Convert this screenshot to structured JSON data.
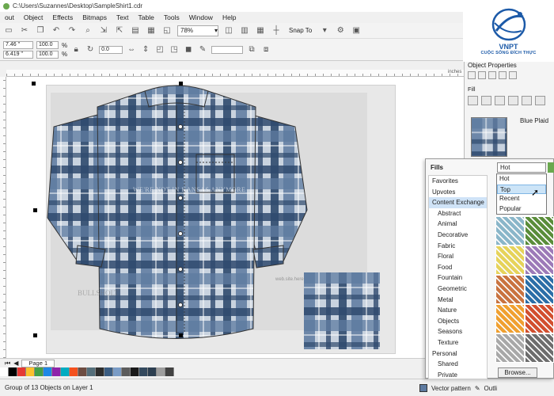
{
  "window": {
    "title": "C:\\Users\\Suzannes\\Desktop\\SampleShirt1.cdr"
  },
  "menu": [
    "out",
    "Object",
    "Effects",
    "Bitmaps",
    "Text",
    "Table",
    "Tools",
    "Window",
    "Help"
  ],
  "logo": {
    "brand": "VNPT",
    "tagline": "CUỘC SỐNG ĐÍCH THỰC"
  },
  "toolbar": {
    "zoom": "78%",
    "snap": "Snap To"
  },
  "propbar": {
    "x": "7.46 \"",
    "y": "6.419 \"",
    "scale_w": "100.0",
    "scale_h": "100.0",
    "pct": "%",
    "angle": "0.0"
  },
  "ruler": {
    "unit": "inches"
  },
  "canvas": {
    "watermark": "WE'RE NOT IN KANSAS ANYMORE",
    "site": "web.site.here",
    "brand_mark": "BULLSHOLT"
  },
  "pages": [
    "Page 1"
  ],
  "status": {
    "left": "Group of 13 Objects on Layer 1",
    "fill": "Vector pattern",
    "outline": "Outli"
  },
  "object_properties": {
    "title": "Object Properties",
    "fill_label": "Fill",
    "fill_name": "Blue Plaid"
  },
  "fills_picker": {
    "title": "Fills",
    "selected": "Hot",
    "options": [
      "Hot",
      "Top",
      "Recent",
      "Popular"
    ],
    "highlighted": "Top",
    "categories": [
      {
        "label": "Favorites",
        "sub": false
      },
      {
        "label": "Upvotes",
        "sub": false
      },
      {
        "label": "Content Exchange",
        "sub": false,
        "selected": true
      },
      {
        "label": "Abstract",
        "sub": true
      },
      {
        "label": "Animal",
        "sub": true
      },
      {
        "label": "Decorative",
        "sub": true
      },
      {
        "label": "Fabric",
        "sub": true
      },
      {
        "label": "Floral",
        "sub": true
      },
      {
        "label": "Food",
        "sub": true
      },
      {
        "label": "Fountain",
        "sub": true
      },
      {
        "label": "Geometric",
        "sub": true
      },
      {
        "label": "Metal",
        "sub": true
      },
      {
        "label": "Nature",
        "sub": true
      },
      {
        "label": "Objects",
        "sub": true
      },
      {
        "label": "Seasons",
        "sub": true
      },
      {
        "label": "Texture",
        "sub": true
      },
      {
        "label": "Personal",
        "sub": false
      },
      {
        "label": "Shared",
        "sub": true
      },
      {
        "label": "Private",
        "sub": true
      }
    ],
    "browse": "Browse..."
  },
  "colors": {
    "plaid_dark": "#2f4a6e",
    "plaid_mid": "#5d7aa0",
    "plaid_light": "#c9d3df",
    "palette": [
      "#ffffff",
      "#000000",
      "#e53935",
      "#fbc02d",
      "#43a047",
      "#1e88e5",
      "#8e24aa",
      "#00acc1",
      "#f4511e",
      "#6d4c41",
      "#546e7a",
      "#2e2e2e",
      "#3b5d82",
      "#7a9cc6",
      "#5c5c5c",
      "#1a1a1a",
      "#34495e",
      "#2c3e50",
      "#9e9e9e",
      "#424242"
    ],
    "thumbs": [
      "#8ab6c9",
      "#5a8d3a",
      "#e6d35a",
      "#9c7ab8",
      "#c9733f",
      "#2b6ea7",
      "#f0a030",
      "#d24f2f",
      "#a8a8a8",
      "#6d6d6d"
    ]
  }
}
